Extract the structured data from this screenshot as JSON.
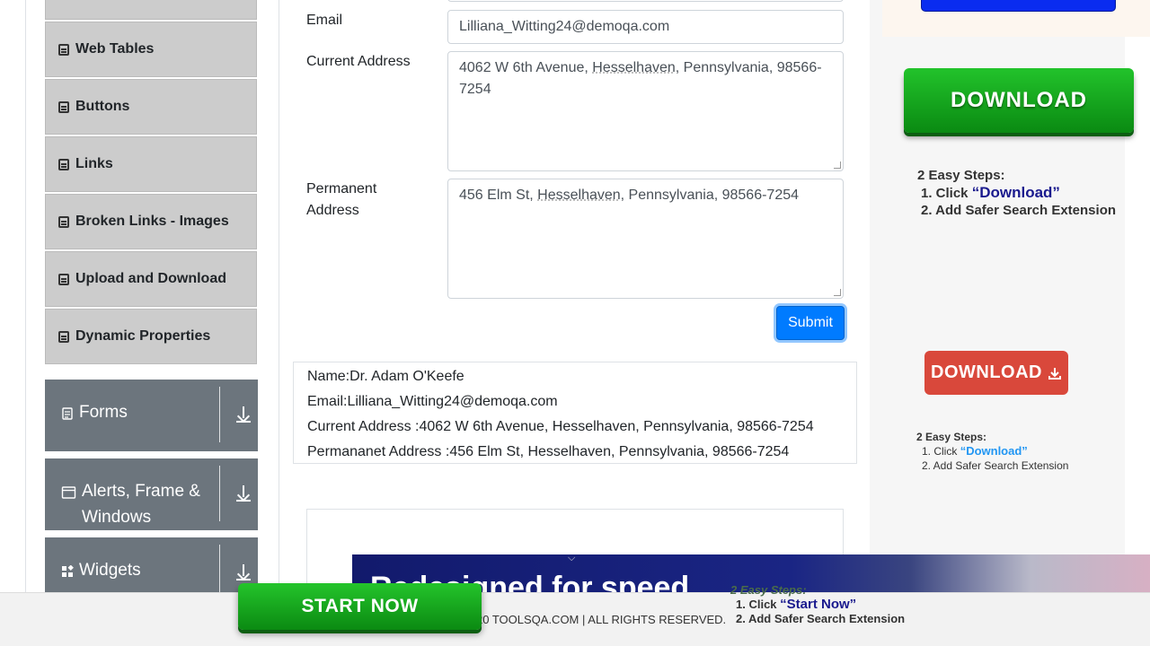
{
  "sidebar": {
    "elements": [
      {
        "label": "Web Tables"
      },
      {
        "label": "Buttons"
      },
      {
        "label": "Links"
      },
      {
        "label": "Broken Links - Images"
      },
      {
        "label": "Upload and Download"
      },
      {
        "label": "Dynamic Properties"
      }
    ],
    "groups": [
      {
        "label": "Forms",
        "icon": "form-icon"
      },
      {
        "label": "Alerts, Frame & Windows",
        "icon": "window-icon"
      },
      {
        "label": "Widgets",
        "icon": "widgets-icon"
      }
    ]
  },
  "form": {
    "email_label": "Email",
    "email_value": "Lilliana_Witting24@demoqa.com",
    "current_label": "Current Address",
    "current_value_a": "4062 W 6th Avenue, ",
    "current_value_b": "Hesselhaven",
    "current_value_c": ", Pennsylvania, 98566-7254",
    "permanent_label": "Permanent Address",
    "permanent_value_a": "456 Elm St, ",
    "permanent_value_b": "Hesselhaven",
    "permanent_value_c": ", Pennsylvania, 98566-7254",
    "submit_label": "Submit"
  },
  "output": {
    "name": "Name:Dr. Adam O'Keefe",
    "email": "Email:Lilliana_Witting24@demoqa.com",
    "current": "Current Address :4062 W 6th Avenue, Hesselhaven, Pennsylvania, 98566-7254",
    "permanent": "Permananet Address :456 Elm St, Hesselhaven, Pennsylvania, 98566-7254"
  },
  "ads": {
    "download_label": "DOWNLOAD",
    "steps_title": "2 Easy Steps:",
    "step1_prefix": "1. Click ",
    "step1_quote": "“Download”",
    "step2": "2. Add Safer Search Extension",
    "red_download_label": "DOWNLOAD",
    "start_now_label": "START NOW",
    "start_step1_quote": "“Start Now”",
    "banner_title": "Redesigned for speed"
  },
  "footer": {
    "text": "20 TOOLSQA.COM | ALL RIGHTS RESERVED."
  },
  "colors": {
    "primary": "#007bff",
    "group_bg": "#6c757d",
    "menu_bg": "#cccccc",
    "download_green": "#1aa922",
    "download_red": "#d9483b"
  }
}
